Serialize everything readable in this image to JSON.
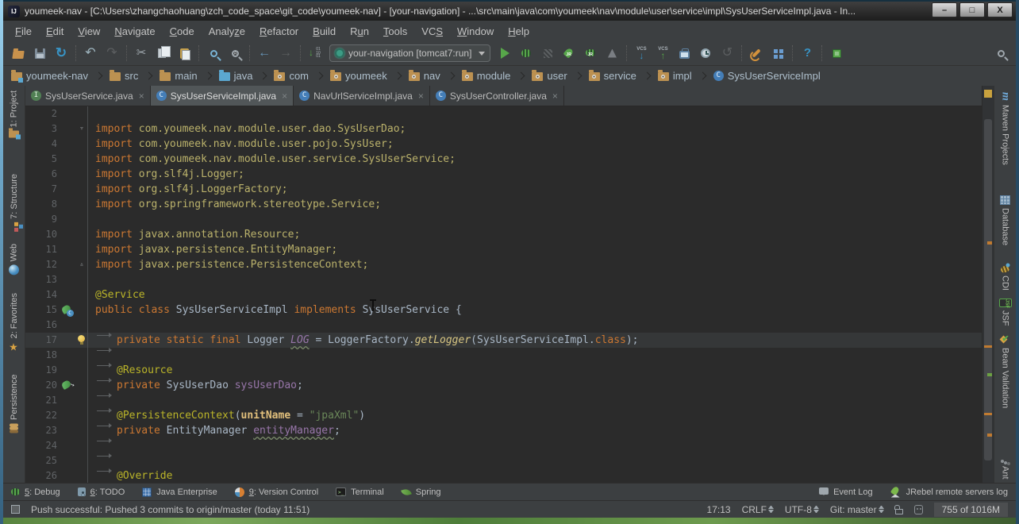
{
  "palette": {
    "ui_bg": "#3C3F41",
    "editor_bg": "#2B2B2B",
    "keyword": "#CC7832",
    "annotation": "#BBB529",
    "string": "#6A8759",
    "field": "#9876AA",
    "import_path": "#BBB26B",
    "run_green": "#57A64A",
    "accent_blue": "#3894C6",
    "warning_stripe": "#C07B31"
  },
  "window": {
    "logo": "IJ",
    "title": "youmeek-nav - [C:\\Users\\zhangchaohuang\\zch_code_space\\git_code\\youmeek-nav] - [your-navigation] - ...\\src\\main\\java\\com\\youmeek\\nav\\module\\user\\service\\impl\\SysUserServiceImpl.java - In..."
  },
  "menubar": [
    {
      "pre": "",
      "mn": "F",
      "post": "ile"
    },
    {
      "pre": "",
      "mn": "E",
      "post": "dit"
    },
    {
      "pre": "",
      "mn": "V",
      "post": "iew"
    },
    {
      "pre": "",
      "mn": "N",
      "post": "avigate"
    },
    {
      "pre": "",
      "mn": "C",
      "post": "ode"
    },
    {
      "pre": "Analy",
      "mn": "z",
      "post": "e"
    },
    {
      "pre": "",
      "mn": "R",
      "post": "efactor"
    },
    {
      "pre": "",
      "mn": "B",
      "post": "uild"
    },
    {
      "pre": "R",
      "mn": "u",
      "post": "n"
    },
    {
      "pre": "",
      "mn": "T",
      "post": "ools"
    },
    {
      "pre": "VC",
      "mn": "S",
      "post": ""
    },
    {
      "pre": "",
      "mn": "W",
      "post": "indow"
    },
    {
      "pre": "",
      "mn": "H",
      "post": "elp"
    }
  ],
  "toolbar": {
    "run_config": "your-navigation [tomcat7:run]"
  },
  "breadcrumbs": [
    {
      "label": "youmeek-nav",
      "icon": "project"
    },
    {
      "label": "src",
      "icon": "folder"
    },
    {
      "label": "main",
      "icon": "folder"
    },
    {
      "label": "java",
      "icon": "srcfolder"
    },
    {
      "label": "com",
      "icon": "package"
    },
    {
      "label": "youmeek",
      "icon": "package"
    },
    {
      "label": "nav",
      "icon": "package"
    },
    {
      "label": "module",
      "icon": "package"
    },
    {
      "label": "user",
      "icon": "package"
    },
    {
      "label": "service",
      "icon": "package"
    },
    {
      "label": "impl",
      "icon": "package"
    },
    {
      "label": "SysUserServiceImpl",
      "icon": "class"
    }
  ],
  "tabs": [
    {
      "label": "SysUserService.java",
      "icon": "interface",
      "active": false
    },
    {
      "label": "SysUserServiceImpl.java",
      "icon": "class",
      "active": true
    },
    {
      "label": "NavUrlServiceImpl.java",
      "icon": "class",
      "active": false
    },
    {
      "label": "SysUserController.java",
      "icon": "class",
      "active": false
    }
  ],
  "editor": {
    "lines": [
      {
        "n": 2,
        "tokens": []
      },
      {
        "n": 3,
        "fold": "down",
        "tokens": [
          {
            "c": "kw",
            "t": "import "
          },
          {
            "c": "imp",
            "t": "com.youmeek.nav.module.user.dao.SysUserDao;"
          }
        ]
      },
      {
        "n": 4,
        "tokens": [
          {
            "c": "kw",
            "t": "import "
          },
          {
            "c": "imp",
            "t": "com.youmeek.nav.module.user.pojo.SysUser;"
          }
        ]
      },
      {
        "n": 5,
        "tokens": [
          {
            "c": "kw",
            "t": "import "
          },
          {
            "c": "imp",
            "t": "com.youmeek.nav.module.user.service.SysUserService;"
          }
        ]
      },
      {
        "n": 6,
        "tokens": [
          {
            "c": "kw",
            "t": "import "
          },
          {
            "c": "imp",
            "t": "org.slf4j.Logger;"
          }
        ]
      },
      {
        "n": 7,
        "tokens": [
          {
            "c": "kw",
            "t": "import "
          },
          {
            "c": "imp",
            "t": "org.slf4j.LoggerFactory;"
          }
        ]
      },
      {
        "n": 8,
        "tokens": [
          {
            "c": "kw",
            "t": "import "
          },
          {
            "c": "imp",
            "t": "org.springframework.stereotype.Service;"
          }
        ]
      },
      {
        "n": 9,
        "tokens": []
      },
      {
        "n": 10,
        "tokens": [
          {
            "c": "kw",
            "t": "import "
          },
          {
            "c": "imp",
            "t": "javax.annotation.Resource;"
          }
        ]
      },
      {
        "n": 11,
        "tokens": [
          {
            "c": "kw",
            "t": "import "
          },
          {
            "c": "imp",
            "t": "javax.persistence.EntityManager;"
          }
        ]
      },
      {
        "n": 12,
        "fold": "up",
        "tokens": [
          {
            "c": "kw",
            "t": "import "
          },
          {
            "c": "imp",
            "t": "javax.persistence.PersistenceContext;"
          }
        ]
      },
      {
        "n": 13,
        "tokens": []
      },
      {
        "n": 14,
        "tokens": [
          {
            "c": "ann",
            "t": "@Service"
          }
        ]
      },
      {
        "n": 15,
        "icon": "bean",
        "tokens": [
          {
            "c": "kw",
            "t": "public class "
          },
          {
            "c": "pl",
            "t": "SysUserServiceImpl "
          },
          {
            "c": "kw",
            "t": "implements "
          },
          {
            "c": "pl",
            "t": "SysUserService {"
          }
        ]
      },
      {
        "n": 16,
        "tokens": [
          {
            "c": "tab"
          }
        ]
      },
      {
        "n": 17,
        "current": true,
        "fold": "bulb",
        "tokens": [
          {
            "c": "tab"
          },
          {
            "c": "kw",
            "t": "private static final "
          },
          {
            "c": "pl",
            "t": "Logger "
          },
          {
            "c": "sfld",
            "t": "LOG"
          },
          {
            "c": "pl",
            "t": " = "
          },
          {
            "c": "pl",
            "t": "LoggerFactory."
          },
          {
            "c": "smeth",
            "t": "getLogger"
          },
          {
            "c": "pl",
            "t": "(SysUserServiceImpl."
          },
          {
            "c": "kw",
            "t": "class"
          },
          {
            "c": "pl",
            "t": ");"
          }
        ]
      },
      {
        "n": 18,
        "tokens": [
          {
            "c": "tab"
          }
        ]
      },
      {
        "n": 19,
        "tokens": [
          {
            "c": "tab"
          },
          {
            "c": "ann",
            "t": "@Resource"
          }
        ]
      },
      {
        "n": 20,
        "icon": "autowire",
        "tokens": [
          {
            "c": "tab"
          },
          {
            "c": "kw",
            "t": "private "
          },
          {
            "c": "pl",
            "t": "SysUserDao "
          },
          {
            "c": "fld",
            "t": "sysUserDao"
          },
          {
            "c": "pl",
            "t": ";"
          }
        ]
      },
      {
        "n": 21,
        "tokens": [
          {
            "c": "tab"
          }
        ]
      },
      {
        "n": 22,
        "tokens": [
          {
            "c": "tab"
          },
          {
            "c": "ann",
            "t": "@PersistenceContext"
          },
          {
            "c": "pl",
            "t": "("
          },
          {
            "c": "attr",
            "t": "unitName"
          },
          {
            "c": "pl",
            "t": " = "
          },
          {
            "c": "str",
            "t": "\"jpaXml\""
          },
          {
            "c": "pl",
            "t": ")"
          }
        ]
      },
      {
        "n": 23,
        "tokens": [
          {
            "c": "tab"
          },
          {
            "c": "kw",
            "t": "private "
          },
          {
            "c": "pl",
            "t": "EntityManager "
          },
          {
            "c": "fldw",
            "t": "entityManager"
          },
          {
            "c": "pl",
            "t": ";"
          }
        ]
      },
      {
        "n": 24,
        "tokens": [
          {
            "c": "tab"
          }
        ]
      },
      {
        "n": 25,
        "tokens": [
          {
            "c": "tab"
          }
        ]
      },
      {
        "n": 26,
        "tokens": [
          {
            "c": "tab"
          },
          {
            "c": "ann",
            "t": "@Override"
          }
        ]
      }
    ]
  },
  "left_bar": [
    {
      "label": "1: Project",
      "icon": "project",
      "gap": 6
    },
    {
      "label": "7: Structure",
      "icon": "structure",
      "gap": 46
    },
    {
      "label": "Web",
      "icon": "web",
      "gap": 28
    },
    {
      "label": "2: Favorites",
      "icon": "favorites",
      "gap": 22
    },
    {
      "label": "Persistence",
      "icon": "persistence",
      "gap": 28
    }
  ],
  "right_bar": [
    {
      "label": "Maven Projects",
      "icon": "maven",
      "gap": 6
    },
    {
      "label": "Database",
      "icon": "database",
      "gap": 38
    },
    {
      "label": "CDI",
      "icon": "cdi",
      "gap": 26
    },
    {
      "label": "JSF",
      "icon": "jsf",
      "gap": 10
    },
    {
      "label": "Bean Validation",
      "icon": "beanval",
      "gap": 10
    },
    {
      "label": "Ant",
      "icon": "ant",
      "gap": 34
    }
  ],
  "bottom_bar": {
    "left": [
      {
        "num": "5",
        "rest": ": Debug",
        "icon": "debug"
      },
      {
        "num": "6",
        "rest": ": TODO",
        "icon": "todo"
      },
      {
        "num": "",
        "rest": "Java Enterprise",
        "icon": "jee"
      },
      {
        "num": "9",
        "rest": ": Version Control",
        "icon": "vcs"
      },
      {
        "num": "",
        "rest": "Terminal",
        "icon": "terminal"
      },
      {
        "num": "",
        "rest": "Spring",
        "icon": "spring"
      }
    ],
    "right": [
      {
        "num": "",
        "rest": "Event Log",
        "icon": "eventlog"
      },
      {
        "num": "",
        "rest": "JRebel remote servers log",
        "icon": "jrebel"
      }
    ]
  },
  "status_bar": {
    "message": "Push successful: Pushed 3 commits to origin/master (today 11:51)",
    "position": "17:13",
    "line_ending": "CRLF",
    "encoding": "UTF-8",
    "git": "Git: master",
    "memory": "755 of 1016M"
  }
}
